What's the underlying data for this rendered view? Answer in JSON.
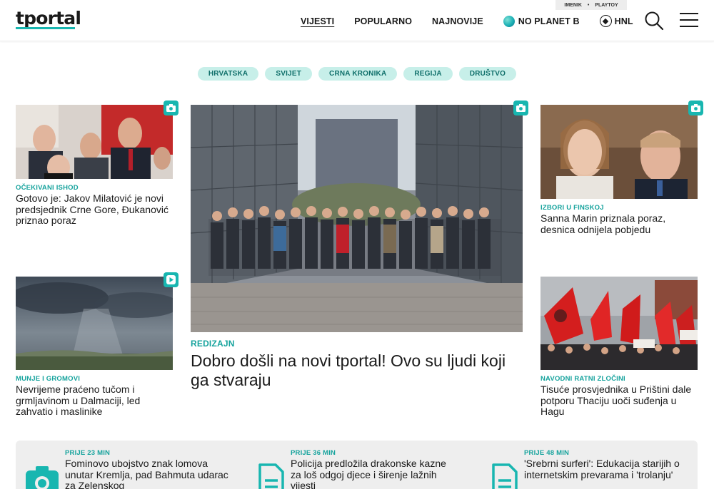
{
  "header": {
    "logo": "tportal",
    "topbar": {
      "left": "IMENIK",
      "sep": "•",
      "right": "PLAYTOY"
    },
    "nav": [
      {
        "label": "VIJESTI"
      },
      {
        "label": "POPULARNO"
      },
      {
        "label": "NAJNOVIJE"
      },
      {
        "label": "NO PLANET B"
      },
      {
        "label": "HNL"
      }
    ],
    "icons": {
      "search": "search-icon",
      "menu": "hamburger-menu-icon"
    }
  },
  "categories": [
    "HRVATSKA",
    "SVIJET",
    "CRNA KRONIKA",
    "REGIJA",
    "DRUŠTVO"
  ],
  "articles": {
    "top_left": {
      "kicker": "OČEKIVANI ISHOD",
      "title": "Gotovo je: Jakov Milatović je novi predsjednik Crne Gore, Đukanović priznao poraz",
      "badge": "camera-icon"
    },
    "bottom_left": {
      "kicker": "MUNJE I GROMOVI",
      "title": "Nevrijeme praćeno tučom i grmljavinom u Dalmaciji, led zahvatio i maslinike",
      "badge": "play-icon"
    },
    "main": {
      "kicker": "REDIZAJN",
      "title": "Dobro došli na novi tportal! Ovo su ljudi koji ga stvaraju",
      "badge": "camera-icon"
    },
    "top_right": {
      "kicker": "IZBORI U FINSKOJ",
      "title": "Sanna Marin priznala poraz, desnica odnijela pobjedu",
      "badge": "camera-icon"
    },
    "bottom_right": {
      "kicker": "NAVODNI RATNI ZLOČINI",
      "title": "Tisuće prosvjednika u Prištini dale potporu Thaciju uoči suđenja u Hagu",
      "badge": "camera-icon"
    }
  },
  "latest": [
    {
      "time": "PRIJE 23 MIN",
      "title": "Fominovo ubojstvo znak lomova unutar Kremlja, pad Bahmuta udarac za Zelenskog",
      "icon": "camera-icon"
    },
    {
      "time": "PRIJE 36 MIN",
      "title": "Policija predložila drakonske kazne za loš odgoj djece i širenje lažnih vijesti",
      "icon": "document-icon"
    },
    {
      "time": "PRIJE 48 MIN",
      "title": "'Srebrni surferi': Edukacija starijih o internetskim prevarama i 'trolanju'",
      "icon": "document-icon"
    }
  ],
  "colors": {
    "accent": "#18b6b0",
    "kicker": "#16a39d",
    "pill_bg": "#c7efe9",
    "pill_text": "#0f6f6a"
  }
}
